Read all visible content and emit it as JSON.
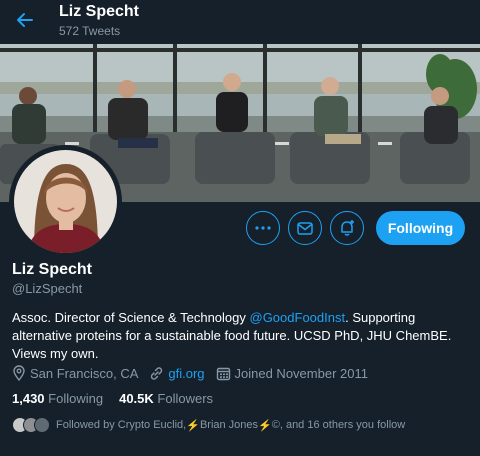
{
  "header": {
    "name": "Liz Specht",
    "tweet_count": "572 Tweets"
  },
  "profile": {
    "name": "Liz Specht",
    "handle": "@LizSpecht",
    "bio_pre": "Assoc. Director of Science & Technology ",
    "bio_mention": "@GoodFoodInst",
    "bio_post": ". Supporting alternative proteins for a sustainable food future. UCSD PhD, JHU ChemBE. Views my own."
  },
  "actions": {
    "following_label": "Following"
  },
  "meta": {
    "location": "San Francisco, CA",
    "website": "gfi.org",
    "joined": "Joined November 2011"
  },
  "stats": {
    "following_count": "1,430",
    "following_label": "Following",
    "followers_count": "40.5K",
    "followers_label": "Followers"
  },
  "followed_by": {
    "prefix": "Followed by Crypto Euclid, ",
    "bolt1": "⚡",
    "name": "Brian Jones",
    "bolt2": "⚡",
    "suffix": "©, and 16 others you follow"
  },
  "colors": {
    "accent": "#1da1f2",
    "background": "#15202b",
    "muted": "#8899a6"
  },
  "icons": [
    "back-arrow-icon",
    "more-icon",
    "envelope-icon",
    "notification-bell-icon",
    "location-pin-icon",
    "link-icon",
    "calendar-icon"
  ]
}
